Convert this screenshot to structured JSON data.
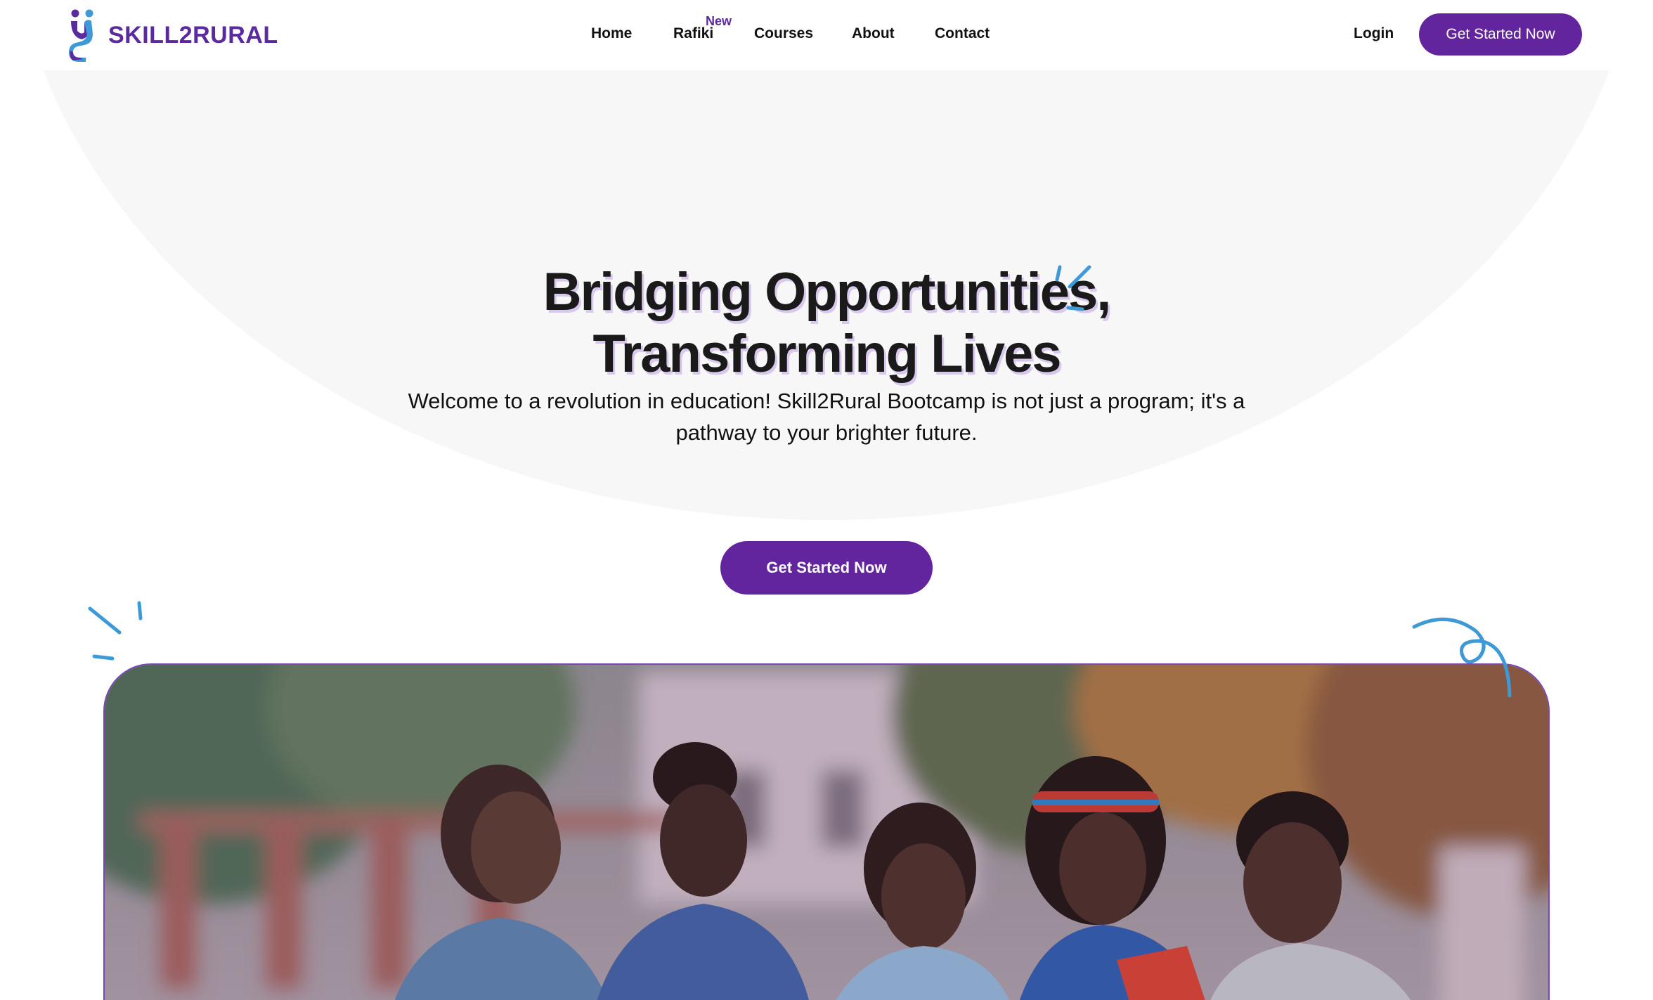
{
  "brand": {
    "name": "SKILL2RURAL",
    "color": "#5b2a9e",
    "icon": "people-logo-icon"
  },
  "nav": {
    "items": [
      {
        "label": "Home"
      },
      {
        "label": "Rafiki",
        "badge": "New"
      },
      {
        "label": "Courses"
      },
      {
        "label": "About"
      },
      {
        "label": "Contact"
      }
    ],
    "login_label": "Login",
    "cta_label": "Get Started Now"
  },
  "hero": {
    "headline_line1": "Bridging Opportunities,",
    "headline_line2": "Transforming Lives",
    "subtitle_line1": "Welcome to a revolution in education! Skill2Rural Bootcamp is not just a program; it's a",
    "subtitle_line2": "pathway to your brighter future.",
    "cta_label": "Get Started Now"
  },
  "image": {
    "subject": "students-studying-photo"
  },
  "colors": {
    "accent": "#62259e",
    "decoration": "#3d9ad6",
    "hero_background": "#f7f7f8"
  }
}
